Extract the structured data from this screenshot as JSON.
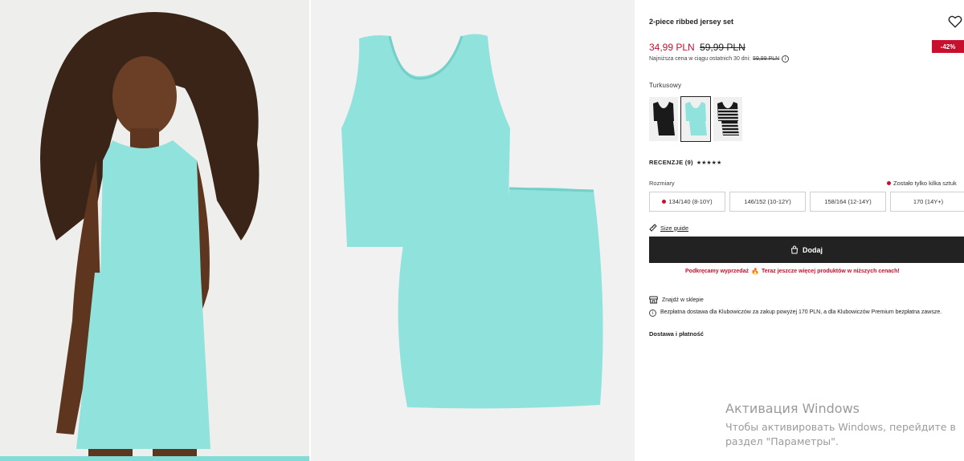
{
  "product": {
    "title": "2-piece ribbed jersey set",
    "price_current": "34,99 PLN",
    "price_old": "59,99 PLN",
    "discount_badge": "-42%",
    "lowest_price_text": "Najniższa cena w ciągu ostatnich 30 dni:",
    "lowest_price_value": "59,99 PLN",
    "color_name": "Turkusowy",
    "reviews_label": "RECENZJE (9)",
    "stars": "★★★★★",
    "sizes_label": "Rozmiary",
    "stock_note": "Zostało tylko kilka sztuk",
    "sizes": [
      {
        "label": "134/140 (8-10Y)",
        "low_stock": true
      },
      {
        "label": "146/152 (10-12Y)",
        "low_stock": false
      },
      {
        "label": "158/164 (12-14Y)",
        "low_stock": false
      },
      {
        "label": "170 (14Y+)",
        "low_stock": false
      }
    ],
    "size_guide": "Size guide",
    "add_button": "Dodaj",
    "promo_text_1": "Podkręcamy wyprzedaż",
    "promo_text_2": "Teraz jeszcze więcej produktów w niższych cenach!",
    "store_label": "Znajdź w sklepie",
    "delivery_text": "Bezpłatna dostawa dla Klubowiczów za zakup powyżej 170 PLN, a dla Klubowiczów Premium bezpłatna zawsze.",
    "payment_label": "Dostawa i płatność"
  },
  "colors": {
    "accent_red": "#c8102e",
    "button_dark": "#222222",
    "garment_turquoise": "#8fe3dc"
  },
  "icons": {
    "wishlist": "heart-icon",
    "info": "info-icon",
    "size_guide": "ruler-icon",
    "bag": "bag-icon",
    "store": "store-icon",
    "flame": "flame-icon"
  },
  "watermark": {
    "title": "Активация Windows",
    "line1": "Чтобы активировать Windows, перейдите в",
    "line2": "раздел \"Параметры\"."
  }
}
